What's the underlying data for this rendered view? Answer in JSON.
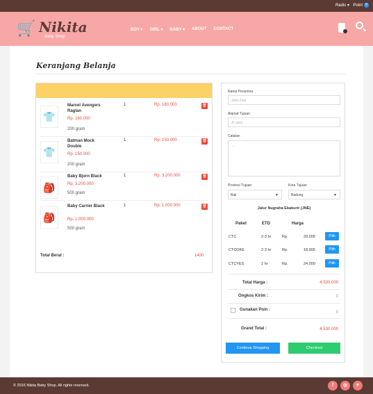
{
  "topbar": {
    "user": "Radis",
    "point_label": "Point",
    "point_badge": "0"
  },
  "header": {
    "brand": "Nikita",
    "tagline": "Baby Shop",
    "nav": [
      "BOY ▾",
      "GIRL ▾",
      "BABY ▾",
      "ABOUT",
      "CONTACT"
    ]
  },
  "page": {
    "title": "Keranjang Belanja"
  },
  "cart": {
    "items": [
      {
        "name": "Marvel Avengers Raglan",
        "qty": "1",
        "subtotal": "Rp. 180.000",
        "price": "Rp. 180.000",
        "weight": "200 gram",
        "thumb": "👕"
      },
      {
        "name": "Batman Mock Double",
        "qty": "1",
        "subtotal": "Rp. 150.000",
        "price": "Rp. 150.000",
        "weight": "200 gram",
        "thumb": "👕"
      },
      {
        "name": "Baby Bjorn Black",
        "qty": "1",
        "subtotal": "Rp. 3.200.000",
        "price": "Rp. 3.200.000",
        "weight": "500 gram",
        "thumb": "🎒"
      },
      {
        "name": "Baby Carrier Black",
        "qty": "1",
        "subtotal": "Rp. 1.000.000",
        "price": "Rp. 1.000.000",
        "weight": "500 gram",
        "thumb": "🎒"
      }
    ],
    "total_weight_label": "Total Berat :",
    "total_weight": "1400"
  },
  "form": {
    "recipient_label": "Nama Penerima",
    "recipient_placeholder": "John Doe",
    "address_label": "Alamat Tujuan",
    "address_placeholder": "Jl. xxxx",
    "notes_label": "Catatan",
    "notes_placeholder": "...",
    "province_label": "Provinsi Tujuan",
    "province_value": "Bali",
    "city_label": "Kota Tujuan",
    "city_value": "Badung",
    "courier": "Jalur Nugraha Ekakurir (JNE)",
    "service_headers": {
      "paket": "Paket",
      "etd": "ETD",
      "harga": "Harga"
    },
    "services": [
      {
        "paket": "CTC",
        "etd": "2-3 hr",
        "currency": "Rp.",
        "price": "20.000",
        "button": "Pilih"
      },
      {
        "paket": "CTCOKE",
        "etd": "2-3 hr",
        "currency": "Rp.",
        "price": "18.000",
        "button": "Pilih"
      },
      {
        "paket": "CTCYES",
        "etd": "1 hr",
        "currency": "Rp.",
        "price": "24.000",
        "button": "Pilih"
      }
    ],
    "total_price_label": "Total Harga :",
    "total_price": "4.530.000",
    "shipping_label": "Ongkos Kirim :",
    "shipping": "0",
    "points_label": "Gunakan Poin :",
    "points": "0",
    "grand_total_label": "Grand Total :",
    "grand_total": "4.530.000",
    "continue_button": "Continue Shopping",
    "checkout_button": "Checkout"
  },
  "footer": {
    "copyright": "© 2016 Nikita Baby Shop. All rights reserved.",
    "social": [
      "f",
      "◎",
      "♥"
    ]
  }
}
